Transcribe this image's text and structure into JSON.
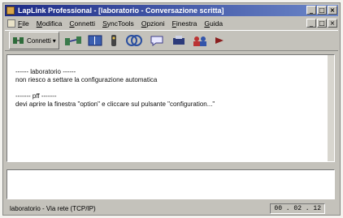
{
  "window": {
    "title": "LapLink Professional - [laboratorio - Conversazione scritta]"
  },
  "menu": {
    "items": [
      "File",
      "Modifica",
      "Connetti",
      "SyncTools",
      "Opzioni",
      "Finestra",
      "Guida"
    ]
  },
  "titlebar_buttons": [
    "_",
    "□",
    "×"
  ],
  "mdi_buttons": [
    "_",
    "□",
    "×"
  ],
  "toolbar": {
    "connect_label": "Connetti",
    "icons": [
      "connect-icon",
      "transfer-icon",
      "file-manager-icon",
      "remote-control-icon",
      "sync-icon",
      "chat-icon",
      "print-icon",
      "users-icon",
      "options-icon"
    ]
  },
  "chat": {
    "messages": [
      {
        "header": "------ laboratorio ------",
        "body": "non riesco a settare la configurazione automatica"
      },
      {
        "header": "------- pff -------",
        "body": "devi aprire la finestra \"option\" e cliccare sul pulsante \"configuration...\""
      }
    ]
  },
  "input": {
    "value": ""
  },
  "status": {
    "text": "laboratorio - Via rete (TCP/IP)",
    "timer": "00 . 02 . 12"
  },
  "colors": {
    "titlebar": "#1d2b86",
    "window_face": "#c4c2bb"
  }
}
